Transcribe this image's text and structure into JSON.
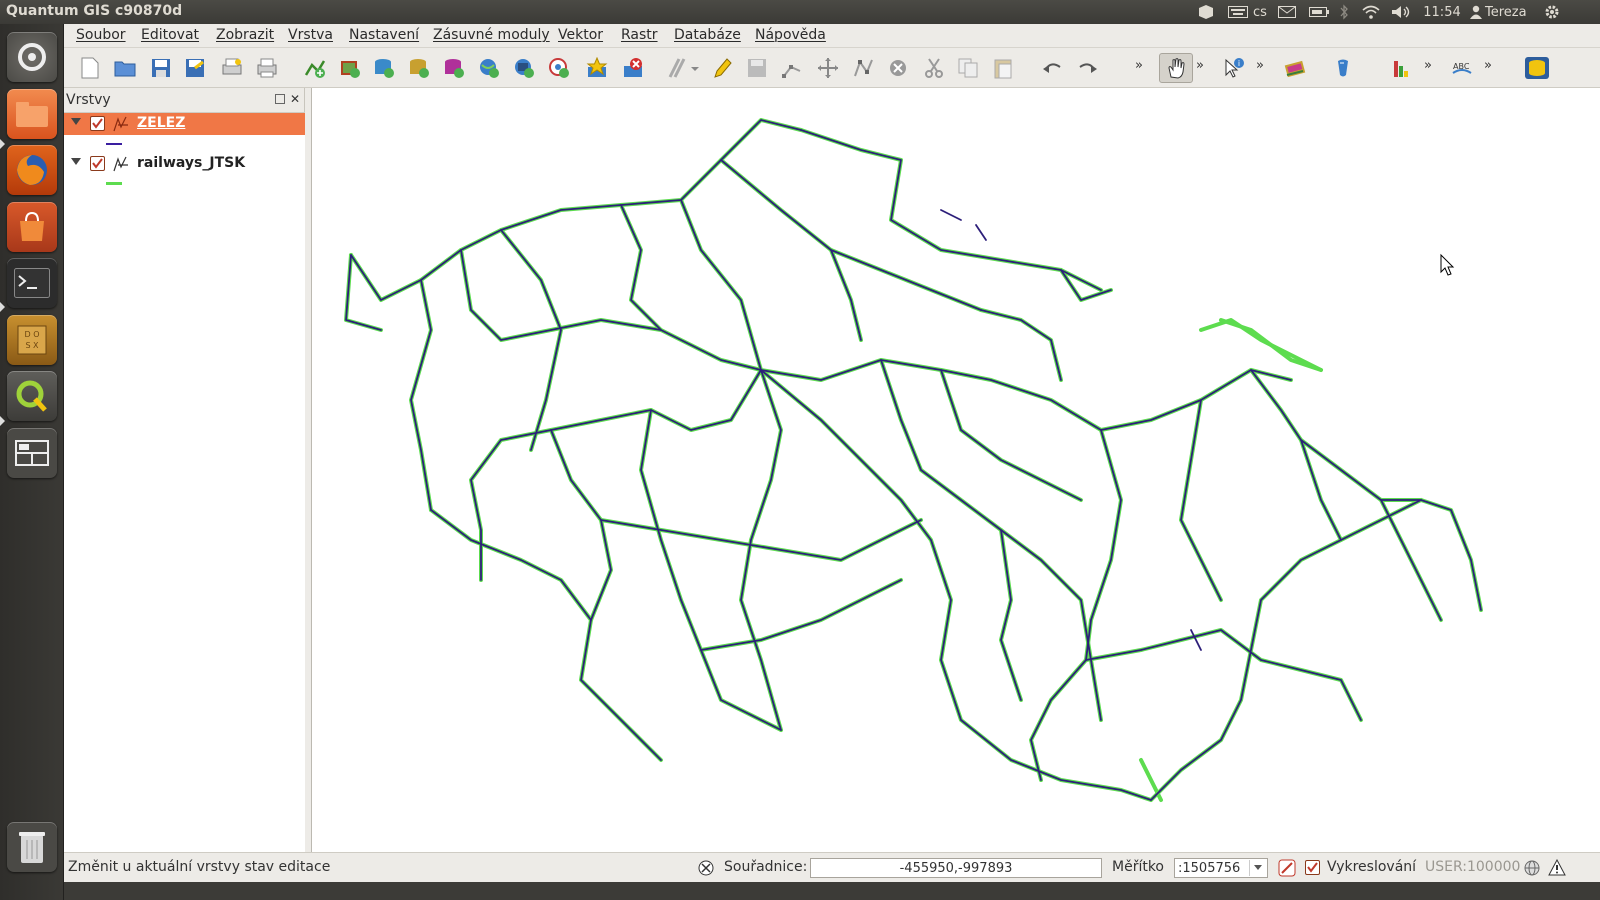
{
  "window": {
    "title": "Quantum GIS c90870d"
  },
  "tray": {
    "keyboard_layout": "cs",
    "time": "11:54",
    "user": "Tereza"
  },
  "launcher": {
    "items": [
      "dash-icon",
      "files-icon",
      "firefox-icon",
      "software-center-icon",
      "terminal-icon",
      "dosbox-icon",
      "qgis-icon",
      "workspace-switcher-icon",
      "trash-icon"
    ]
  },
  "menubar": {
    "items": [
      "Soubor",
      "Editovat",
      "Zobrazit",
      "Vrstva",
      "Nastavení",
      "Zásuvné moduly",
      "Vektor",
      "Rastr",
      "Databáze",
      "Nápověda"
    ]
  },
  "toolbar": {
    "icons": [
      "new-project-icon",
      "open-project-icon",
      "save-project-icon",
      "save-as-icon",
      "print-composer-icon",
      "print-icon",
      "add-vector-layer-icon",
      "add-raster-layer-icon",
      "add-postgis-layer-icon",
      "add-spatialite-layer-icon",
      "add-mssql-layer-icon",
      "add-wms-layer-icon",
      "add-wcs-layer-icon",
      "add-wfs-layer-icon",
      "new-shapefile-icon",
      "remove-layer-icon",
      "digitize-icon",
      "toggle-editing-icon",
      "save-edits-icon",
      "add-feature-icon",
      "move-feature-icon",
      "node-tool-icon",
      "delete-selected-icon",
      "cut-features-icon",
      "copy-features-icon",
      "paste-features-icon",
      "undo-icon",
      "redo-icon",
      "pan-icon",
      "identify-icon",
      "map-tips-icon",
      "python-icon",
      "histogram-icon",
      "label-icon",
      "db-manager-icon"
    ]
  },
  "layers_panel": {
    "title": "Vrstvy",
    "layers": [
      {
        "name": "ZELEZ",
        "checked": true,
        "selected": true,
        "color": "#3a1ea0"
      },
      {
        "name": "railways_JTSK",
        "checked": true,
        "selected": false,
        "color": "#5ddc4f"
      }
    ]
  },
  "map": {
    "dark_line_color": "#2d1f7a",
    "light_line_color": "#5ddc4f"
  },
  "statusbar": {
    "message": "Změnit u aktuální vrstvy stav editace",
    "coordinates_label": "Souřadnice:",
    "coordinates_value": "-455950,-997893",
    "scale_label": "Měřítko",
    "scale_value": ":1505756",
    "render_label": "Vykreslování",
    "render_checked": true,
    "crs": "USER:100000"
  },
  "colors": {
    "selected_row": "#f07746",
    "ubuntu_panel": "#3c3b37"
  }
}
